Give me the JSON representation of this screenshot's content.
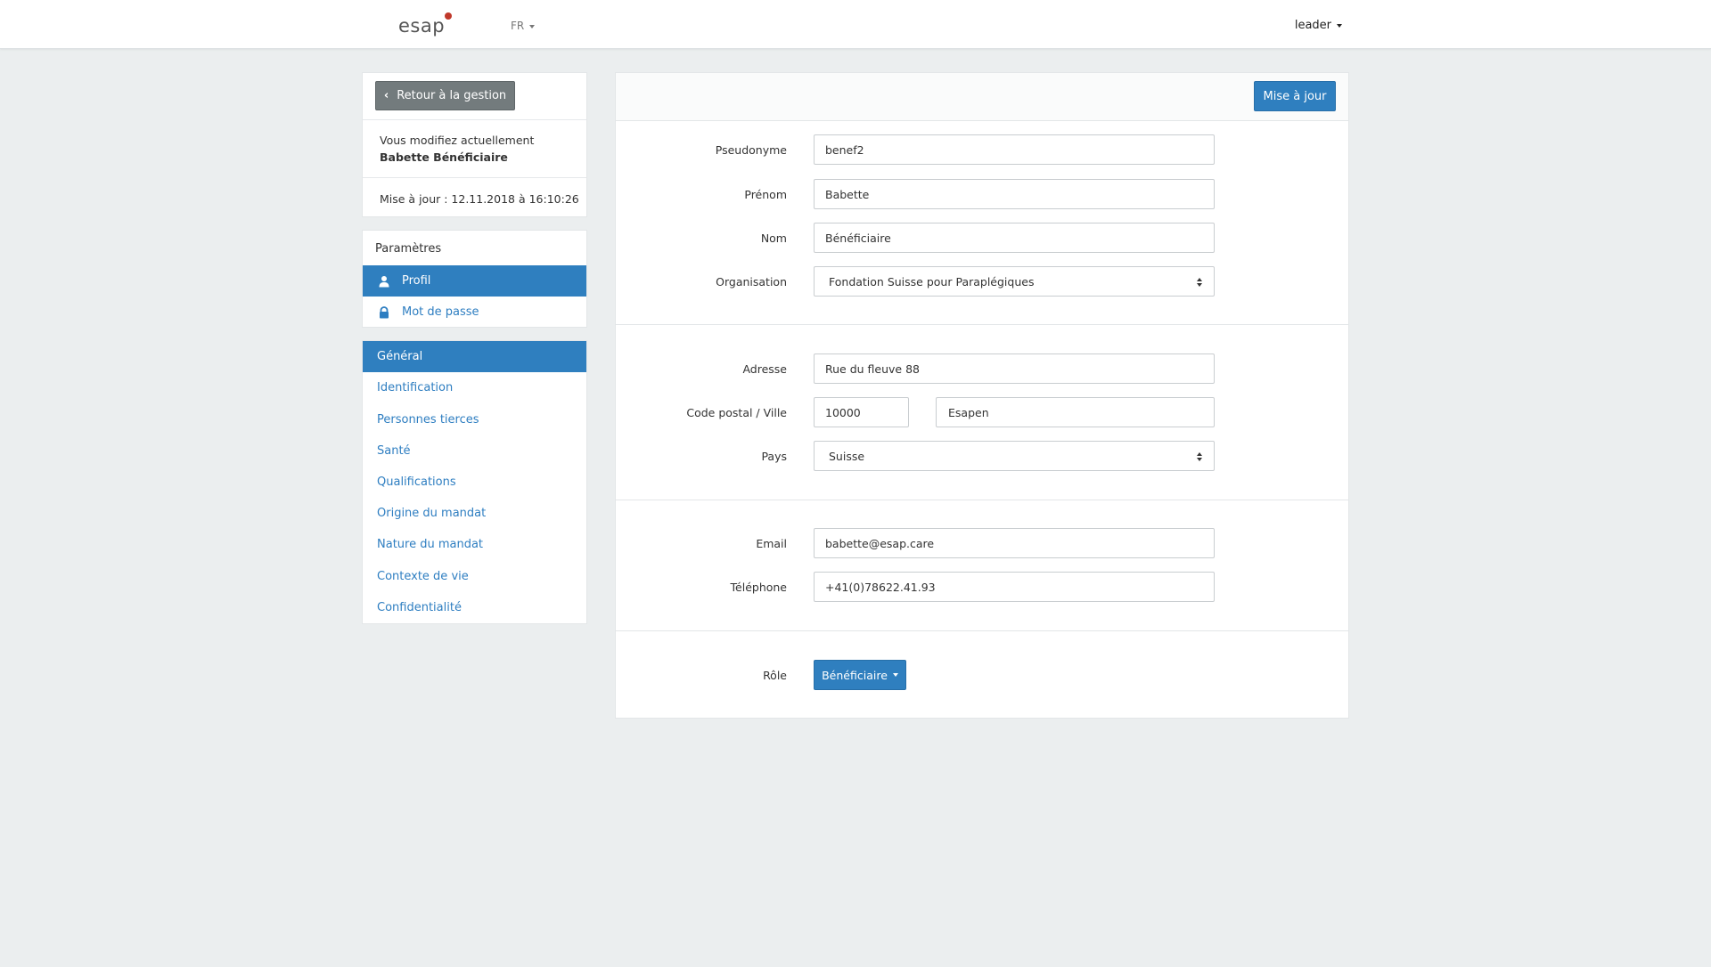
{
  "topbar": {
    "logo": "esap",
    "language": "FR",
    "user": "leader"
  },
  "sidebar": {
    "back_button": "Retour à la gestion",
    "editing_label": "Vous modifiez actuellement",
    "editing_name": "Babette Bénéficiaire",
    "updated": "Mise à jour : 12.11.2018 à 16:10:26",
    "settings_title": "Paramètres",
    "settings_items": [
      {
        "label": "Profil",
        "icon": "user-icon",
        "active": true
      },
      {
        "label": "Mot de passe",
        "icon": "lock-icon",
        "active": false
      }
    ],
    "general_title": "Général",
    "general_items": [
      "Identification",
      "Personnes tierces",
      "Santé",
      "Qualifications",
      "Origine du mandat",
      "Nature du mandat",
      "Contexte de vie",
      "Confidentialité"
    ]
  },
  "form": {
    "update_button": "Mise à jour",
    "pseudonym": {
      "label": "Pseudonyme",
      "value": "benef2"
    },
    "firstname": {
      "label": "Prénom",
      "value": "Babette"
    },
    "lastname": {
      "label": "Nom",
      "value": "Bénéficiaire"
    },
    "organisation": {
      "label": "Organisation",
      "value": "Fondation Suisse pour Paraplégiques"
    },
    "address": {
      "label": "Adresse",
      "value": "Rue du fleuve 88"
    },
    "postal_city": {
      "label": "Code postal / Ville",
      "postal": "10000",
      "city": "Esapen"
    },
    "country": {
      "label": "Pays",
      "value": "Suisse"
    },
    "email": {
      "label": "Email",
      "value": "babette@esap.care"
    },
    "phone": {
      "label": "Téléphone",
      "value": "+41(0)78622.41.93"
    },
    "role": {
      "label": "Rôle",
      "value": "Bénéficiaire"
    }
  },
  "colors": {
    "primary": "#2f7fbf",
    "background": "#ebeeef",
    "back_button": "#737b7d",
    "link": "#2e7ec1"
  }
}
